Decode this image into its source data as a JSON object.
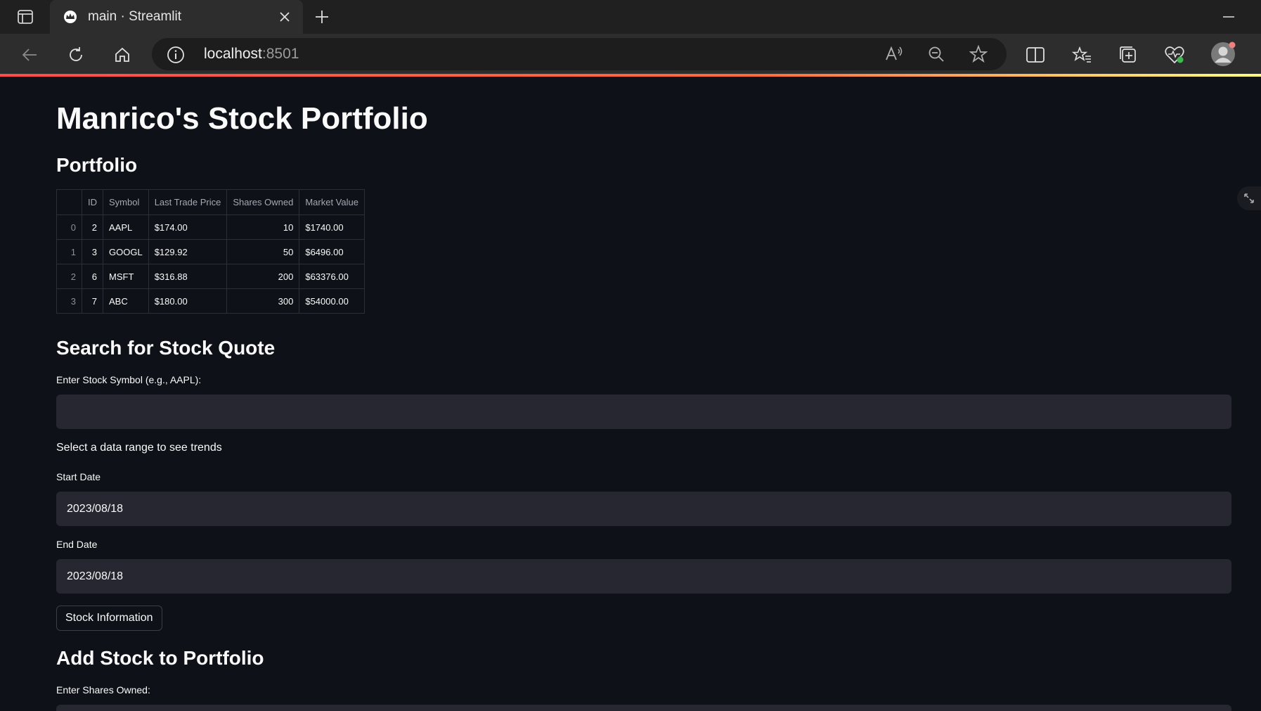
{
  "browser": {
    "tab_title": "main · Streamlit",
    "url_host": "localhost",
    "url_port": ":8501"
  },
  "page": {
    "title": "Manrico's Stock Portfolio",
    "portfolio_heading": "Portfolio",
    "table": {
      "columns": [
        "",
        "ID",
        "Symbol",
        "Last Trade Price",
        "Shares Owned",
        "Market Value"
      ],
      "rows": [
        {
          "index": "0",
          "id": "2",
          "symbol": "AAPL",
          "price": "$174.00",
          "shares": "10",
          "value": "$1740.00"
        },
        {
          "index": "1",
          "id": "3",
          "symbol": "GOOGL",
          "price": "$129.92",
          "shares": "50",
          "value": "$6496.00"
        },
        {
          "index": "2",
          "id": "6",
          "symbol": "MSFT",
          "price": "$316.88",
          "shares": "200",
          "value": "$63376.00"
        },
        {
          "index": "3",
          "id": "7",
          "symbol": "ABC",
          "price": "$180.00",
          "shares": "300",
          "value": "$54000.00"
        }
      ]
    },
    "search_heading": "Search for Stock Quote",
    "symbol_label": "Enter Stock Symbol (e.g., AAPL):",
    "symbol_value": "",
    "range_text": "Select a data range to see trends",
    "start_label": "Start Date",
    "start_value": "2023/08/18",
    "end_label": "End Date",
    "end_value": "2023/08/18",
    "stock_info_button": "Stock Information",
    "add_heading": "Add Stock to Portfolio",
    "shares_label": "Enter Shares Owned:"
  },
  "colors": {
    "background": "#0e1117",
    "input_bg": "#262730",
    "accent": "#ff4b4b"
  }
}
